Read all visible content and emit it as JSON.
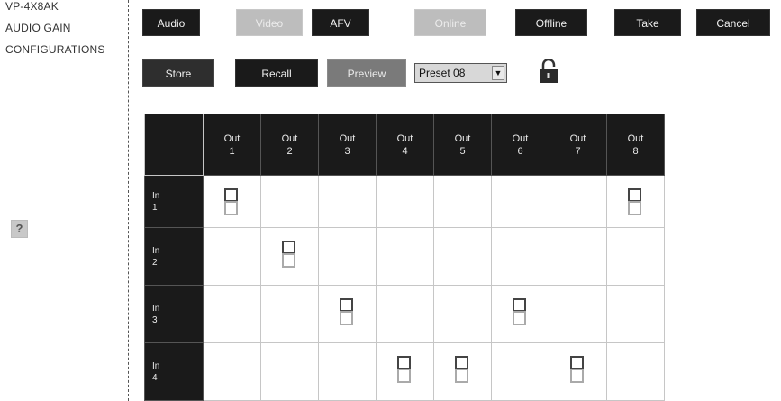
{
  "device": {
    "model": "VP-4X8AK",
    "line2": "AUDIO GAIN",
    "line3": "CONFIGURATIONS"
  },
  "help_label": "?",
  "toolbar": {
    "audio": "Audio",
    "video": "Video",
    "afv": "AFV",
    "online": "Online",
    "offline": "Offline",
    "take": "Take",
    "cancel": "Cancel"
  },
  "preset_bar": {
    "store": "Store",
    "recall": "Recall",
    "preview": "Preview",
    "preset_selected": "Preset 08",
    "lock_state": "unlocked"
  },
  "matrix": {
    "outputs": [
      {
        "out": "Out",
        "num": "1"
      },
      {
        "out": "Out",
        "num": "2"
      },
      {
        "out": "Out",
        "num": "3"
      },
      {
        "out": "Out",
        "num": "4"
      },
      {
        "out": "Out",
        "num": "5"
      },
      {
        "out": "Out",
        "num": "6"
      },
      {
        "out": "Out",
        "num": "7"
      },
      {
        "out": "Out",
        "num": "8"
      }
    ],
    "inputs": [
      {
        "in": "In",
        "num": "1"
      },
      {
        "in": "In",
        "num": "2"
      },
      {
        "in": "In",
        "num": "3"
      },
      {
        "in": "In",
        "num": "4"
      }
    ],
    "routes": {
      "in1": [
        1,
        8
      ],
      "in2": [
        2
      ],
      "in3": [
        3,
        6
      ],
      "in4": [
        4,
        5,
        7
      ]
    }
  }
}
